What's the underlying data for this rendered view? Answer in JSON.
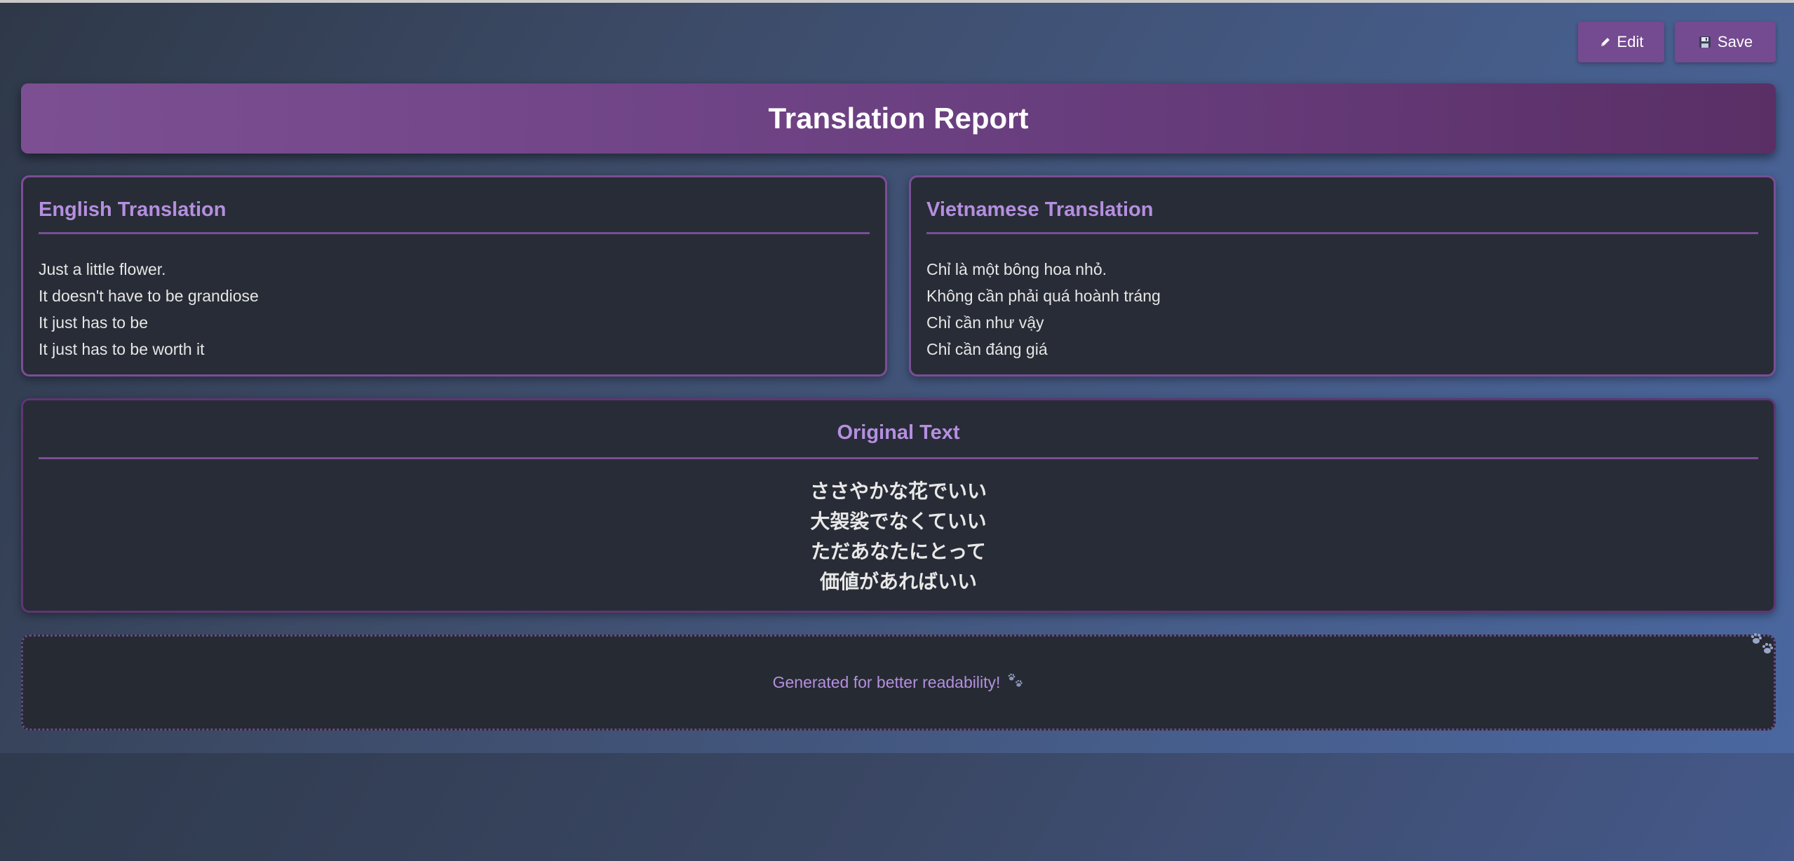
{
  "toolbar": {
    "edit_label": "Edit",
    "save_label": "Save",
    "edit_icon": "pencil-icon",
    "save_icon": "floppy-disk-icon",
    "button_color": "#744a90"
  },
  "header": {
    "title": "Translation Report"
  },
  "english": {
    "heading": "English Translation",
    "lines": [
      "Just a little flower.",
      "It doesn't have to be grandiose",
      "It just has to be",
      "It just has to be worth it"
    ]
  },
  "vietnamese": {
    "heading": "Vietnamese Translation",
    "lines": [
      "Chỉ là một bông hoa nhỏ.",
      "Không cần phải quá hoành tráng",
      "Chỉ cần như vậy",
      "Chỉ cần đáng giá"
    ]
  },
  "original": {
    "heading": "Original Text",
    "lines": [
      "ささやかな花でいい",
      "大袈裟でなくていい",
      "ただあなたにとって",
      "価値があればいい"
    ]
  },
  "footer": {
    "text": "Generated for better readability!",
    "icon": "paw-prints-icon"
  },
  "colors": {
    "accent": "#b48fe0",
    "border": "#7a4e96",
    "card_bg": "#282c36"
  }
}
